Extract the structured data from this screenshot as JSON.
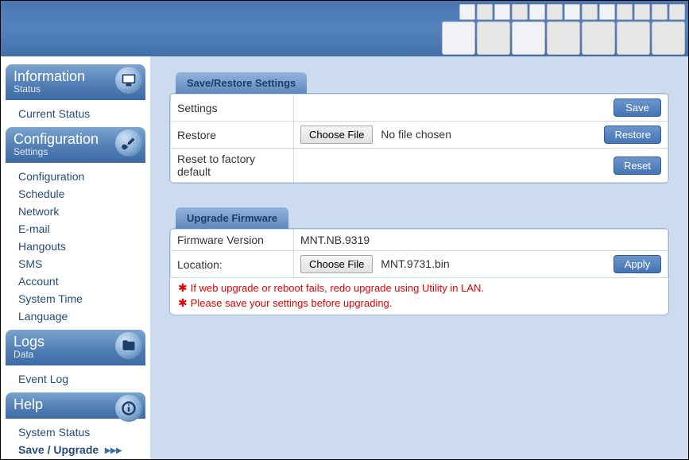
{
  "sidebar": {
    "information": {
      "title": "Information",
      "subtitle": "Status",
      "items": [
        "Current Status"
      ]
    },
    "configuration": {
      "title": "Configuration",
      "subtitle": "Settings",
      "items": [
        "Configuration",
        "Schedule",
        "Network",
        "E-mail",
        "Hangouts",
        "SMS",
        "Account",
        "System Time",
        "Language"
      ]
    },
    "logs": {
      "title": "Logs",
      "subtitle": "Data",
      "items": [
        "Event Log"
      ]
    },
    "help": {
      "title": "Help",
      "items": [
        "System Status",
        "Save / Upgrade"
      ]
    }
  },
  "panel1": {
    "tab": "Save/Restore Settings",
    "row_settings": "Settings",
    "row_restore": "Restore",
    "row_reset": "Reset to factory default",
    "choose_file": "Choose File",
    "no_file": "No file chosen",
    "btn_save": "Save",
    "btn_restore": "Restore",
    "btn_reset": "Reset"
  },
  "panel2": {
    "tab": "Upgrade Firmware",
    "row_version_label": "Firmware Version",
    "row_version_value": "MNT.NB.9319",
    "row_location_label": "Location:",
    "choose_file": "Choose File",
    "file_name": "MNT.9731.bin",
    "btn_apply": "Apply",
    "note1": "If web upgrade or reboot fails, redo upgrade using Utility in LAN.",
    "note2": "Please save your settings before upgrading."
  }
}
